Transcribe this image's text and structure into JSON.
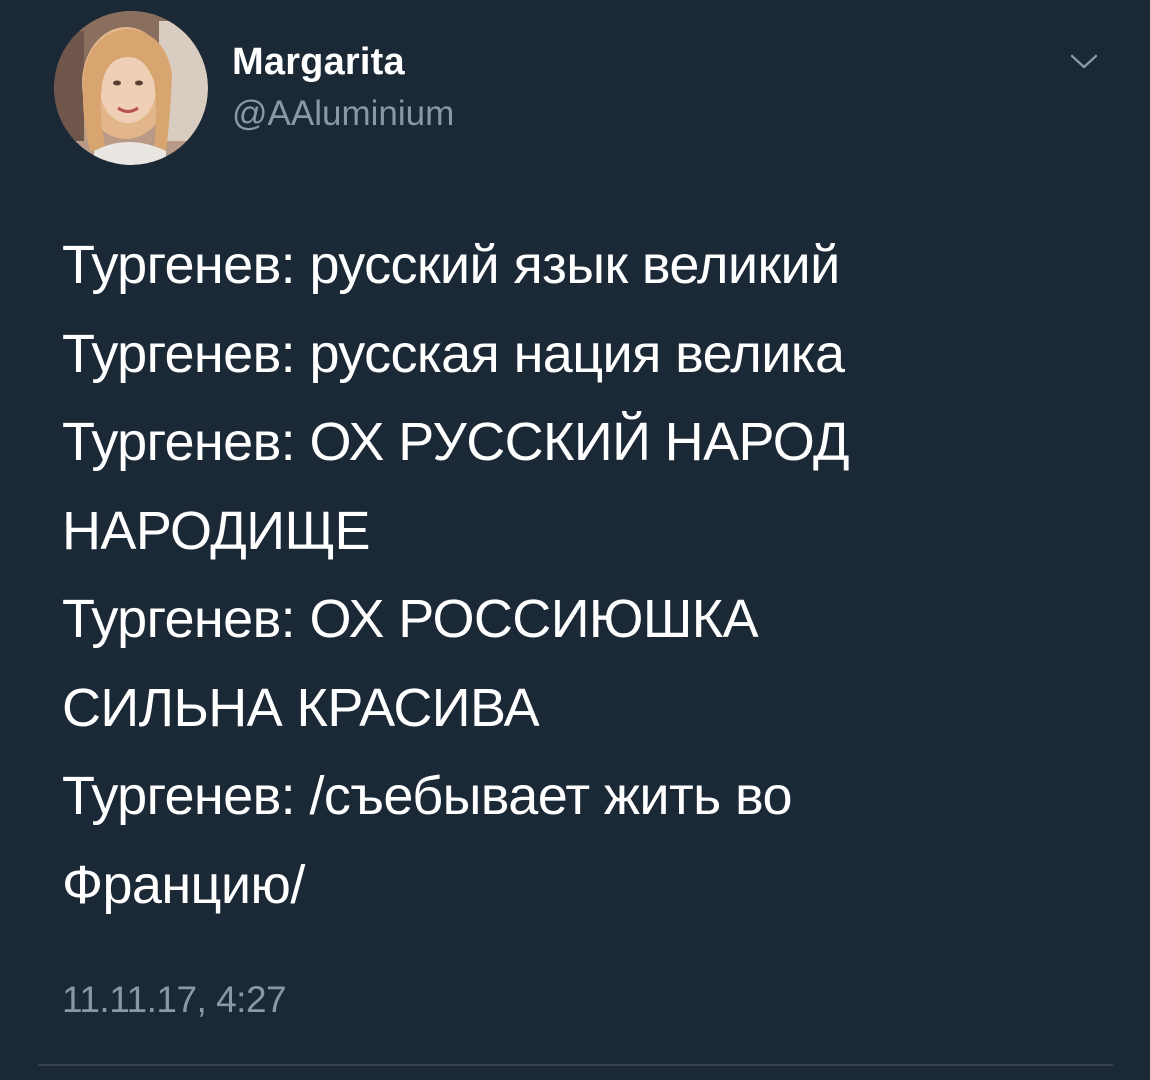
{
  "author": {
    "display_name": "Margarita",
    "handle": "@AAluminium"
  },
  "icons": {
    "avatar": "avatar",
    "menu": "chevron-down-icon"
  },
  "tweet": {
    "lines": [
      "Тургенев: русский язык великий",
      "Тургенев: русская нация велика",
      "Тургенев: ОХ РУССКИЙ НАРОД",
      "НАРОДИЩЕ",
      "Тургенев: ОХ РОССИЮШКА",
      "СИЛЬНА КРАСИВА",
      "Тургенев: /съебывает жить во",
      "Францию/"
    ],
    "timestamp": "11.11.17, 4:27"
  },
  "colors": {
    "background": "#1b2836",
    "text_primary": "#ffffff",
    "text_secondary": "#8899a6",
    "divider": "#38444d"
  }
}
